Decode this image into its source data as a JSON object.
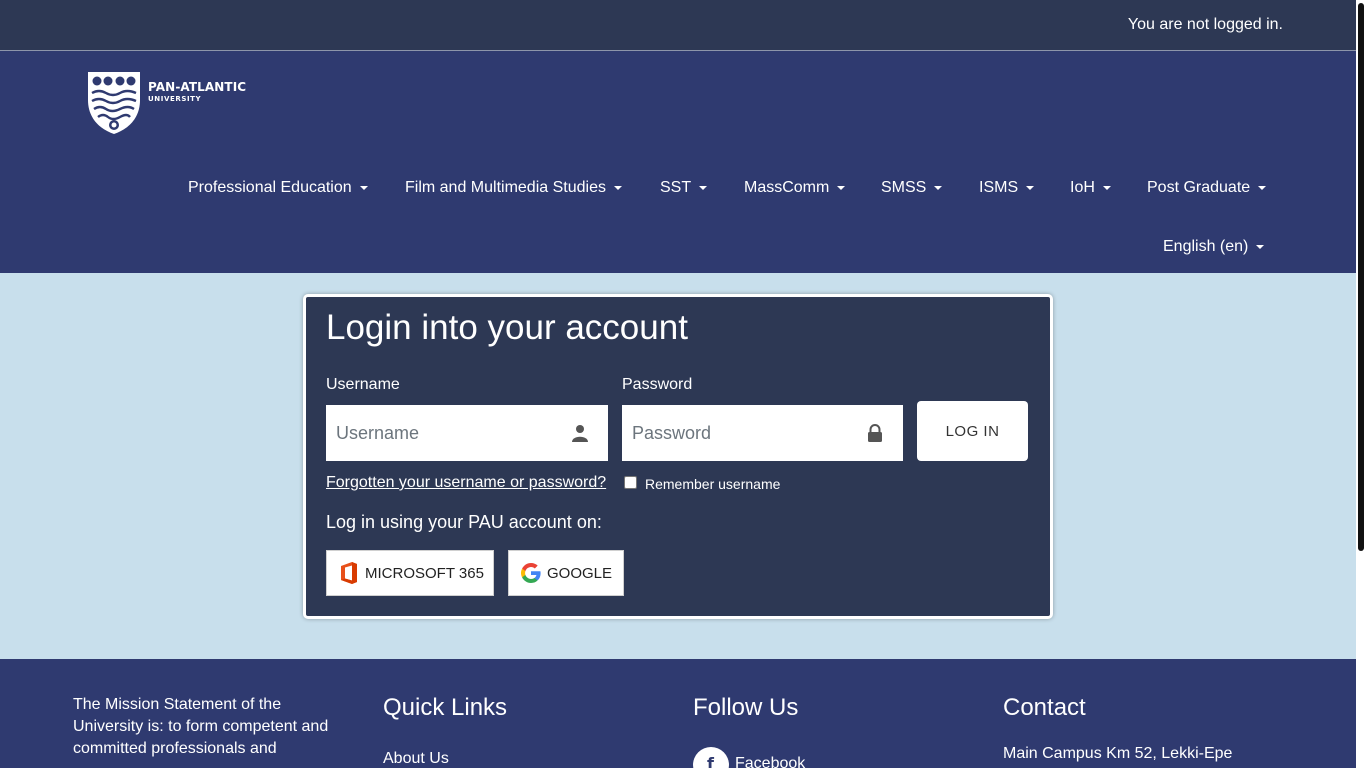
{
  "topbar": {
    "login_status": "You are not logged in."
  },
  "header": {
    "logo": {
      "name": "PAN-ATLANTIC",
      "sub": "UNIVERSITY"
    },
    "nav": [
      {
        "label": "Professional Education"
      },
      {
        "label": "Film and Multimedia Studies"
      },
      {
        "label": "SST"
      },
      {
        "label": "MassComm"
      },
      {
        "label": "SMSS"
      },
      {
        "label": "ISMS"
      },
      {
        "label": "IoH"
      },
      {
        "label": "Post Graduate"
      }
    ],
    "language": {
      "label": "English (en)"
    }
  },
  "login": {
    "title": "Login into your account",
    "username_label": "Username",
    "username_placeholder": "Username",
    "username_value": "",
    "password_label": "Password",
    "password_placeholder": "Password",
    "password_value": "",
    "login_button": "LOG IN",
    "forgot_link": "Forgotten your username or password?",
    "remember_label": "Remember username",
    "remember_checked": false,
    "sso_lead": "Log in using your PAU account on:",
    "sso": {
      "microsoft": {
        "label": "MICROSOFT 365",
        "icon": "office-icon"
      },
      "google": {
        "label": "GOOGLE",
        "icon": "google-icon"
      }
    }
  },
  "footer": {
    "mission": "The Mission Statement of the University is: to form competent and committed professionals and",
    "quick_links": {
      "heading": "Quick Links",
      "items": [
        {
          "label": "About Us"
        }
      ]
    },
    "follow_us": {
      "heading": "Follow Us",
      "items": [
        {
          "label": "Facebook",
          "icon": "facebook-icon"
        }
      ]
    },
    "contact": {
      "heading": "Contact",
      "address": "Main Campus Km 52, Lekki-Epe"
    }
  },
  "colors": {
    "topbar": "#2d3854",
    "header": "#2f3a70",
    "page_background": "#c8dfec",
    "card": "#2d3854",
    "footer": "#2f3a70"
  }
}
